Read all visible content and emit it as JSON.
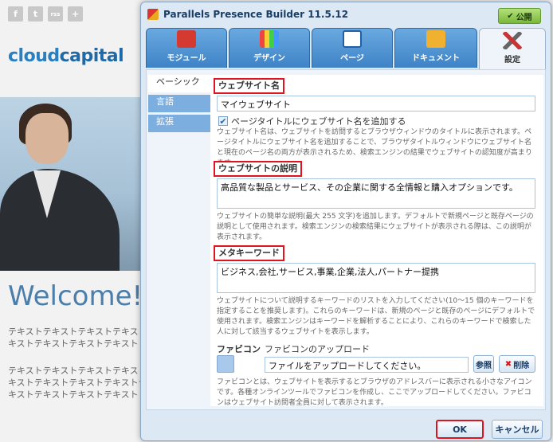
{
  "site": {
    "social": [
      "f",
      "t",
      "rss",
      "+"
    ],
    "brand_part1": "cloud",
    "brand_part2": "capital",
    "welcome": "Welcome!",
    "text_lines": [
      "テキストテキストテキストテキストテ",
      "キストテキストテキストテキスト",
      "テキストテキストテキストテキストテ",
      "キストテキストテキストテキストテ",
      "キストテキストテキストテキスト"
    ]
  },
  "dialog": {
    "title": "Parallels Presence Builder 11.5.12",
    "publish_label": "公開",
    "tabs": [
      {
        "label": "モジュール",
        "icon": "module-icon"
      },
      {
        "label": "デザイン",
        "icon": "design-icon"
      },
      {
        "label": "ページ",
        "icon": "pages-icon"
      },
      {
        "label": "ドキュメント",
        "icon": "documents-icon"
      },
      {
        "label": "設定",
        "icon": "settings-icon"
      }
    ],
    "active_tab": "設定",
    "subnav": [
      {
        "label": "ベーシック",
        "active": true
      },
      {
        "label": "言語",
        "active": false
      },
      {
        "label": "拡張",
        "active": false
      }
    ],
    "form": {
      "site_name_label": "ウェブサイト名",
      "site_name_value": "マイウェブサイト",
      "add_to_title_label": "ページタイトルにウェブサイト名を追加する",
      "add_to_title_checked": true,
      "site_name_help": "ウェブサイト名は、ウェブサイトを訪問するとブラウザウィンドウのタイトルに表示されます。ページタイトルにウェブサイト名を追加することで、ブラウザタイトルウィンドウにウェブサイト名と現在のページ名の両方が表示されるため、検索エンジンの結果でウェブサイトの認知度が高まります。",
      "description_label": "ウェブサイトの説明",
      "description_value": "高品質な製品とサービス、その企業に関する全情報と購入オプションです。",
      "description_help": "ウェブサイトの簡単な説明(最大 255 文字)を追加します。デフォルトで新規ページと既存ページの説明として使用されます。検索エンジンの検索結果にウェブサイトが表示される際は、この説明が表示されます。",
      "keywords_label": "メタキーワード",
      "keywords_value": "ビジネス,会社,サービス,事業,企業,法人,パートナー提携",
      "keywords_help": "ウェブサイトについて説明するキーワードのリストを入力してください(10～15 個のキーワードを指定することを推奨します)。これらのキーワードは、新規のページと既存のページにデフォルトで使用されます。検索エンジンはキーワードを解析することにより、これらのキーワードで検索した人に対して該当するウェブサイトを表示します。",
      "favicon_label": "ファビコン",
      "favicon_upload_label": "ファビコンのアップロード",
      "favicon_placeholder": "ファイルをアップロードしてください。",
      "browse_label": "参照",
      "delete_label": "削除",
      "favicon_help": "ファビコンとは、ウェブサイトを表示するとブラウザのアドレスバーに表示される小さなアイコンです。各種オンラインツールでファビコンを作成し、ここでアップロードしてください。ファビコンはウェブサイト訪問者全員に対して表示されます。"
    },
    "ok_label": "OK",
    "cancel_label": "キャンセル"
  }
}
